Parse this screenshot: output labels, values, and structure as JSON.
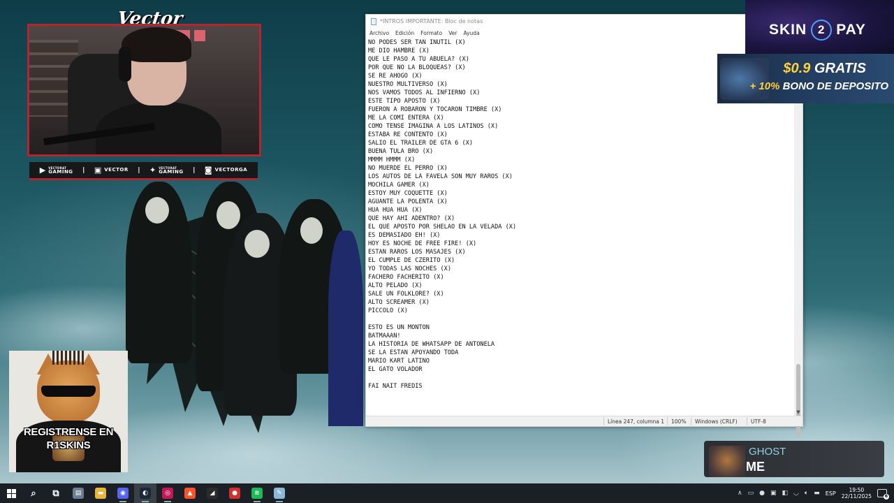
{
  "stream_overlay": {
    "streamer_logo": "Vector",
    "socials": [
      {
        "icon": "youtube-icon",
        "top": "VECTORAT",
        "label": "GAMING"
      },
      {
        "icon": "twitch-icon",
        "top": "",
        "label": "VECTOR"
      },
      {
        "icon": "twitter-icon",
        "top": "VECTORAT",
        "label": "GAMING"
      },
      {
        "icon": "instagram-icon",
        "top": "",
        "label": "VECTORGA"
      }
    ],
    "promo_caption_line1": "REGISTRENSE EN",
    "promo_caption_line2": "R1SKINS",
    "brand_color": "#b2272f"
  },
  "sponsor": {
    "logo_left": "SKIN",
    "logo_mid": "2",
    "logo_right": "PAY",
    "promo_amount": "$0.9",
    "promo_free": "GRATIS",
    "promo_bonus_pct": "+ 10%",
    "promo_bonus_text": "BONO DE DEPOSITO"
  },
  "now_playing": {
    "artist": "GHOST",
    "song": "ME"
  },
  "notepad": {
    "title": "*INTROS IMPORTANTE: Bloc de notas",
    "menu": [
      "Archivo",
      "Edición",
      "Formato",
      "Ver",
      "Ayuda"
    ],
    "lines": [
      "NO PODES SER TAN INUTIL (X)",
      "ME DIO HAMBRE (X)",
      "QUE LE PASO A TU ABUELA? (X)",
      "POR QUE NO LA BLOQUEAS? (X)",
      "SE RE AHOGO (X)",
      "NUESTRO MULTIVERSO (X)",
      "NOS VAMOS TODOS AL INFIERNO (X)",
      "ESTE TIPO APOSTO (X)",
      "FUERON A ROBARON Y TOCARON TIMBRE (X)",
      "ME LA COMI ENTERA (X)",
      "COMO TENSE IMAGINA A LOS LATINOS (X)",
      "ESTABA RE CONTENTO (X)",
      "SALIO EL TRAILER DE GTA 6 (X)",
      "BUENA TULA BRO (X)",
      "MMMM HMMM (X)",
      "NO MUERDE EL PERRO (X)",
      "LOS AUTOS DE LA FAVELA SON MUY RAROS (X)",
      "MOCHILA GAMER (X)",
      "ESTOY MUY COQUETTE (X)",
      "AGUANTE LA POLENTA (X)",
      "HUA HUA HUA (X)",
      "QUE HAY AHI ADENTRO? (X)",
      "EL QUE APOSTO POR SHELAO EN LA VELADA (X)",
      "ES DEMASIADO EH! (X)",
      "HOY ES NOCHE DE FREE FIRE! (X)",
      "ESTAN RAROS LOS MASAJES (X)",
      "EL CUMPLE DE CZERITO (X)",
      "YO TODAS LAS NOCHES (X)",
      "FACHERO FACHERITO (X)",
      "ALTO PELADO (X)",
      "SALE UN FOLKLORE? (X)",
      "ALTO SCREAMER (X)",
      "PICCOLO (X)",
      "",
      "ESTO ES UN MONTON",
      "BATMAAAN!",
      "LA HISTORIA DE WHATSAPP DE ANTONELA",
      "SE LA ESTAN APOYANDO TODA",
      "MARIO KART LATINO",
      "EL GATO VOLADOR",
      "",
      "FAI NAIT FREDIS"
    ],
    "status": {
      "position": "Línea 247, columna 1",
      "zoom": "100%",
      "line_endings": "Windows (CRLF)",
      "encoding": "UTF-8"
    }
  },
  "taskbar": {
    "apps": [
      {
        "name": "start-button",
        "kind": "win"
      },
      {
        "name": "search-button",
        "glyph": "⌕",
        "color": "transparent"
      },
      {
        "name": "task-view-button",
        "glyph": "⧉",
        "color": "transparent"
      },
      {
        "name": "file-explorer-app",
        "glyph": "▤",
        "color": "#6d7f8f"
      },
      {
        "name": "folder-app",
        "glyph": "▬",
        "color": "#e9b53a"
      },
      {
        "name": "discord-app",
        "glyph": "◉",
        "color": "#5865f2"
      },
      {
        "name": "steam-app",
        "glyph": "◐",
        "color": "#1b2838"
      },
      {
        "name": "obs-app",
        "glyph": "◎",
        "color": "#c2185b"
      },
      {
        "name": "brave-app",
        "glyph": "▲",
        "color": "#fb542b"
      },
      {
        "name": "epic-app",
        "glyph": "◢",
        "color": "#2b2b2b"
      },
      {
        "name": "recorder-app",
        "glyph": "●",
        "color": "#d32f2f"
      },
      {
        "name": "spotify-app",
        "glyph": "≋",
        "color": "#1db954"
      },
      {
        "name": "notepad-app",
        "glyph": "✎",
        "color": "#8fb8d8"
      }
    ],
    "tray": {
      "language": "ESP",
      "time": "19:50",
      "date": "22/11/2025",
      "notifications": "6"
    }
  }
}
